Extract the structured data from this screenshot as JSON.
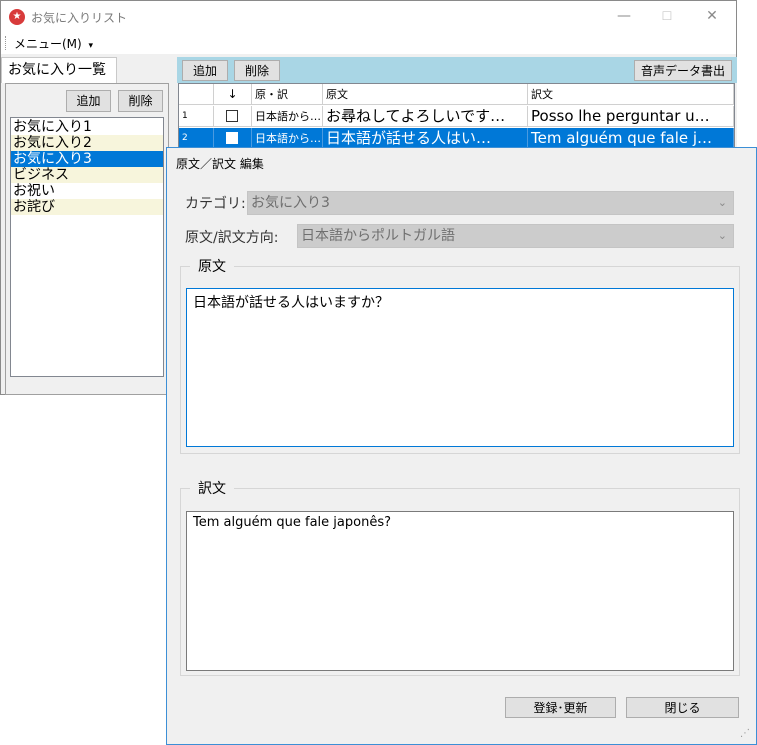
{
  "main": {
    "title": "お気に入りリスト",
    "menu_label": "メニュー(M)",
    "menu_arrow": "▾",
    "minimize": "—",
    "maximize": "☐",
    "close": "✕",
    "left_tab": "お気に入り一覧",
    "left_add": "追加",
    "left_delete": "削除",
    "categories": [
      "お気に入り1",
      "お気に入り2",
      "お気に入り3",
      "ビジネス",
      "お祝い",
      "お詫び"
    ],
    "toolbar_add": "追加",
    "toolbar_delete": "削除",
    "toolbar_export": "音声データ書出",
    "grid": {
      "headers": [
        "",
        "↓",
        "原・訳",
        "原文",
        "訳文"
      ],
      "rows": [
        {
          "num": "1",
          "dir": "日本語から…",
          "orig": "お尋ねしてよろしいです…",
          "trans": "Posso lhe perguntar u…"
        },
        {
          "num": "2",
          "dir": "日本語から…",
          "orig": "日本語が話せる人はい…",
          "trans": "Tem alguém que fale j…"
        }
      ]
    }
  },
  "dialog": {
    "title": "原文／訳文 編集",
    "category_label": "カテゴリ:",
    "category_value": "お気に入り3",
    "direction_label": "原文/訳文方向:",
    "direction_value": "日本語からポルトガル語",
    "orig_group": "原文",
    "orig_text": "日本語が話せる人はいますか？",
    "trans_group": "訳文",
    "trans_text": "Tem alguém que fale japonês?",
    "save_button": "登録･更新",
    "close_button": "閉じる"
  },
  "colors": {
    "selection": "#0078d7",
    "alt_row": "#f7f5dc",
    "toolbar_blue": "#a9d6e5",
    "dialog_border": "#3c8fd6"
  }
}
